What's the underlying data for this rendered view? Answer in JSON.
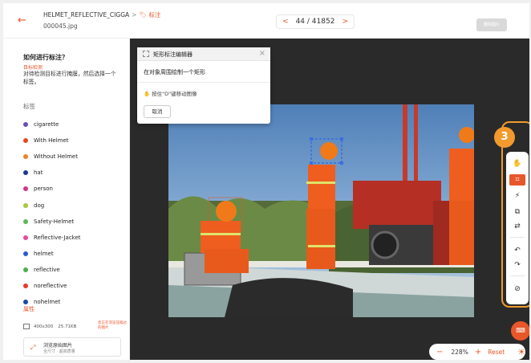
{
  "header": {
    "back_icon": "←",
    "filename_part": "HELMET_REFLECTIVE_CIGGA",
    "separator": ">",
    "tag_label": "标注",
    "filename_line2": "000045.jpg",
    "pager": {
      "prev": "<",
      "current": "44 / 41852",
      "next": ">"
    },
    "right_button": "删除图片"
  },
  "sidebar": {
    "howto_title": "如何进行标注？",
    "howto_subtitle": "目标检测",
    "howto_desc": "对待检测目标进行掩膜，然后选择一个标签。",
    "labels_heading": "标签",
    "labels": [
      {
        "name": "cigarette",
        "color": "#6b4fb0"
      },
      {
        "name": "With Helmet",
        "color": "#e84a1e"
      },
      {
        "name": "Without Helmet",
        "color": "#e8842a"
      },
      {
        "name": "hat",
        "color": "#1e3a8c"
      },
      {
        "name": "person",
        "color": "#d63384"
      },
      {
        "name": "dog",
        "color": "#a6c93a"
      },
      {
        "name": "Safety-Helmet",
        "color": "#5cb85c"
      },
      {
        "name": "Reflective-Jacket",
        "color": "#e84a9a"
      },
      {
        "name": "helmet",
        "color": "#2a5bd7"
      },
      {
        "name": "reflective",
        "color": "#4caf50"
      },
      {
        "name": "noreflective",
        "color": "#e83a2a"
      },
      {
        "name": "nohelmet",
        "color": "#1e4aa0"
      }
    ],
    "attributes_heading": "属性",
    "meta": {
      "dims": "400x300",
      "size": "25.71KB",
      "warn": "您正在浏览压缩过的图片"
    },
    "browse": {
      "line1": "浏览原始图片",
      "line2": "全尺寸 · 超高质量"
    }
  },
  "editor": {
    "title": "矩形标注编辑器",
    "instruction": "在对象周围绘制一个矩形",
    "hint": "按住\"D\"键移动图像",
    "cancel": "取消",
    "close": "×"
  },
  "toolbar": {
    "badge": "3",
    "tools": [
      "hand-icon",
      "rect-icon",
      "magic-wand-icon",
      "copy-icon",
      "swap-icon",
      "undo-icon",
      "redo-icon",
      "clear-icon"
    ]
  },
  "zoom": {
    "minus": "−",
    "value": "228%",
    "plus": "+",
    "reset": "Reset"
  },
  "fab_icon": "keyboard-icon",
  "colors": {
    "accent": "#e8572a",
    "highlight": "#f29a2e"
  }
}
